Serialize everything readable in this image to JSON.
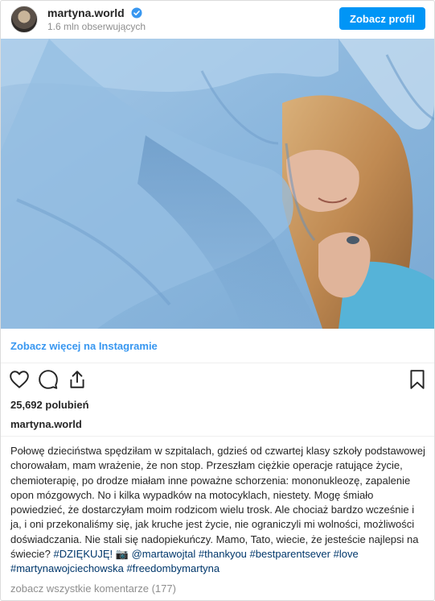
{
  "header": {
    "username": "martyna.world",
    "followers": "1.6 mln obserwujących",
    "profile_button": "Zobacz profil"
  },
  "post": {
    "view_more_link": "Zobacz więcej na Instagramie",
    "likes": "25,692 polubień",
    "author": "martyna.world",
    "caption": {
      "text": "Połowę dzieciństwa spędziłam w szpitalach, gdzieś od czwartej klasy szkoły podstawowej chorowałam, mam wrażenie, że non stop. Przeszłam ciężkie operacje ratujące życie, chemioterapię, po drodze miałam inne poważne schorzenia: mononukleozę, zapalenie opon mózgowych. No i kilka wypadków na motocyklach, niestety. Mogę śmiało powiedzieć, że dostarczyłam moim rodzicom wielu trosk. Ale chociaż bardzo wcześnie i ja, i oni przekonaliśmy się, jak kruche jest życie, nie ograniczyli mi wolności, możliwości doświadczania. Nie stali się nadopiekuńczy. Mamo, Tato, wiecie, że jesteście najlepsi na świecie?",
      "hashtag_thanks": "#DZIĘKUJĘ!",
      "camera_emoji": "📷",
      "mention": "@martawojtal",
      "hashtags": [
        "#thankyou",
        "#bestparentsever",
        "#love",
        "#martynawojciechowska",
        "#freedombymartyna"
      ]
    },
    "comments_link": "zobacz wszystkie komentarze (177)"
  },
  "icons": {
    "verified": "verified-badge-icon",
    "like": "heart-icon",
    "comment": "comment-bubble-icon",
    "share": "share-icon",
    "save": "bookmark-icon"
  },
  "colors": {
    "primary_button": "#0095f6",
    "link_blue": "#3897f0",
    "hashtag": "#00376b",
    "muted_text": "#8e8e8e",
    "fabric_blue": "#8fb9dc"
  }
}
